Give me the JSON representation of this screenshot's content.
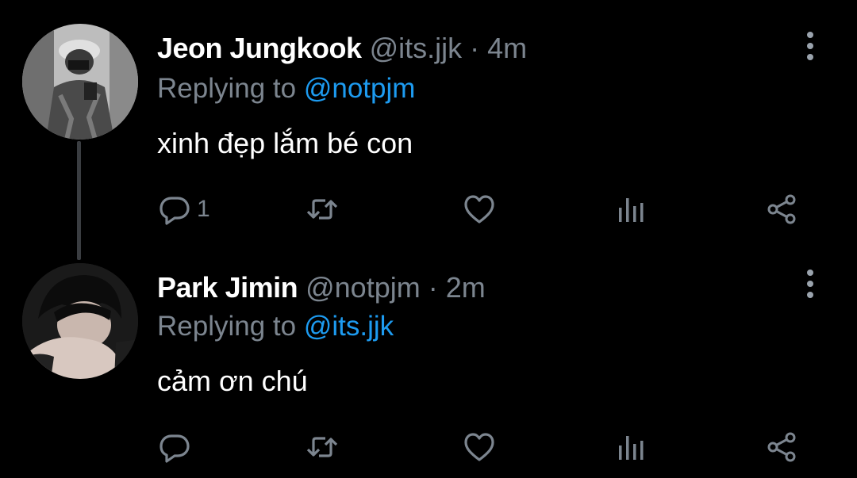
{
  "tweets": [
    {
      "name": "Jeon Jungkook",
      "handle": "@its.jjk",
      "separator": "·",
      "time": "4m",
      "replying_prefix": "Replying to",
      "replying_to": "@notpjm",
      "text": "xinh đẹp lắm bé con",
      "reply_count": "1",
      "icons": [
        "reply-icon",
        "retweet-icon",
        "like-icon",
        "views-icon",
        "share-icon",
        "more-icon"
      ]
    },
    {
      "name": "Park Jimin",
      "handle": "@notpjm",
      "separator": "·",
      "time": "2m",
      "replying_prefix": "Replying to",
      "replying_to": "@its.jjk",
      "text": "cảm ơn chú",
      "reply_count": "",
      "icons": [
        "reply-icon",
        "retweet-icon",
        "like-icon",
        "views-icon",
        "share-icon",
        "more-icon"
      ]
    }
  ],
  "colors": {
    "background": "#000000",
    "text": "#ffffff",
    "muted": "#7c858f",
    "link": "#1d9bf0",
    "thread_line": "#3a3d41"
  }
}
